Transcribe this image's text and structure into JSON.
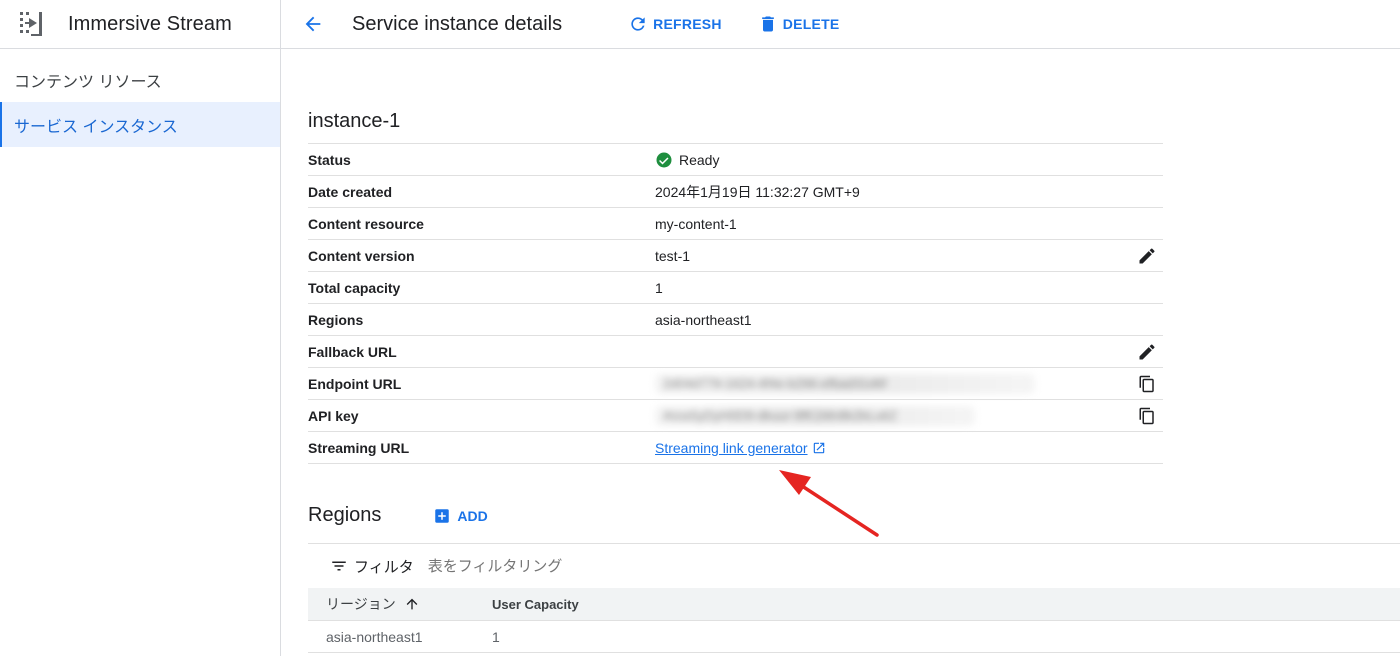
{
  "app": {
    "title": "Immersive Stream"
  },
  "sidebar": {
    "items": [
      {
        "label": "コンテンツ リソース"
      },
      {
        "label": "サービス インスタンス"
      }
    ]
  },
  "header": {
    "title": "Service instance details",
    "refresh_label": "REFRESH",
    "delete_label": "DELETE"
  },
  "instance": {
    "name": "instance-1",
    "rows": [
      {
        "label": "Status",
        "value": "Ready"
      },
      {
        "label": "Date created",
        "value": "2024年1月19日 11:32:27 GMT+9"
      },
      {
        "label": "Content resource",
        "value": "my-content-1"
      },
      {
        "label": "Content version",
        "value": "test-1"
      },
      {
        "label": "Total capacity",
        "value": "1"
      },
      {
        "label": "Regions",
        "value": "asia-northeast1"
      },
      {
        "label": "Fallback URL",
        "value": ""
      },
      {
        "label": "Endpoint URL",
        "value": "2d04d779-1624-4f4e-b296-efbad31d6f"
      },
      {
        "label": "API key",
        "value": "AIzaSyDyH0D9-dkuur-9fK1Mn8k2bLu6Z"
      },
      {
        "label": "Streaming URL",
        "value": "Streaming link generator"
      }
    ]
  },
  "regions": {
    "title": "Regions",
    "add_label": "ADD",
    "filter_label": "フィルタ",
    "filter_placeholder": "表をフィルタリング",
    "columns": [
      "リージョン",
      "User Capacity"
    ],
    "rows": [
      {
        "region": "asia-northeast1",
        "capacity": "1"
      }
    ]
  },
  "colors": {
    "accent": "#1a73e8",
    "ready": "#1e8e3e",
    "annotation_arrow": "#e52521"
  }
}
